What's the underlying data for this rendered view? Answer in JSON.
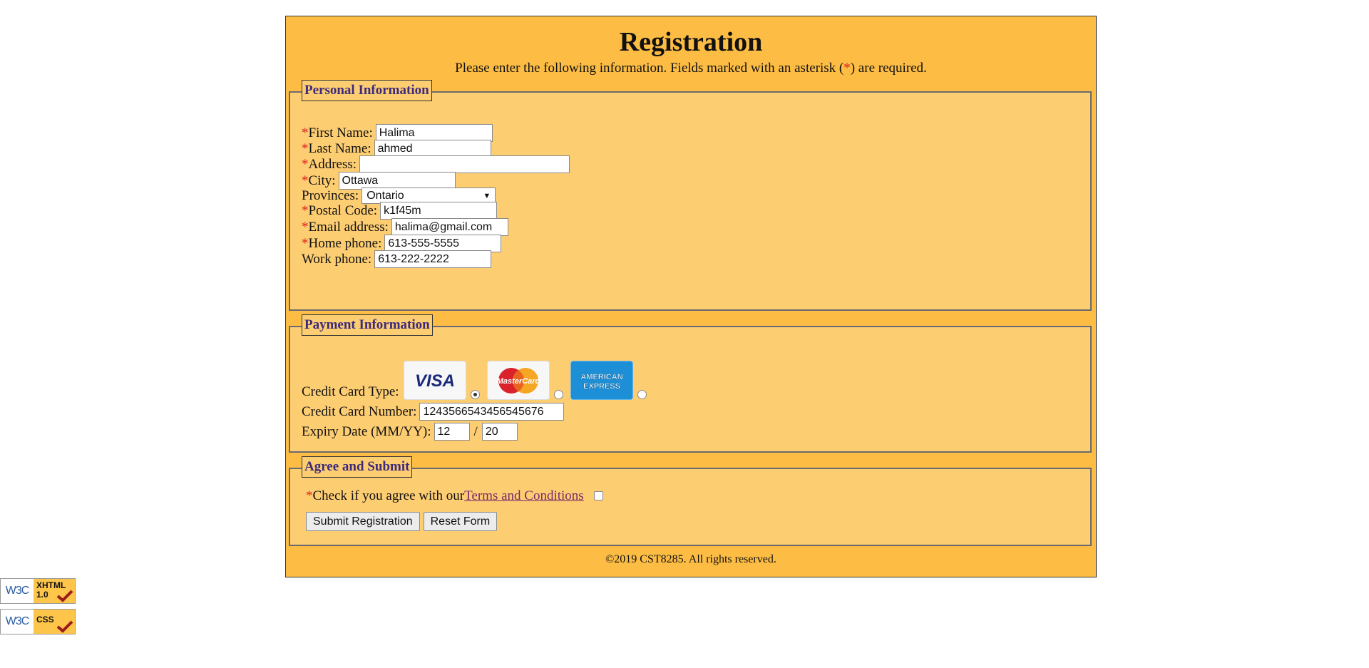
{
  "header": {
    "title": "Registration",
    "intro_before": "Please enter the following information. Fields marked with an asterisk (",
    "intro_asterisk": "*",
    "intro_after": ") are required."
  },
  "personal": {
    "legend": "Personal Information",
    "first_name": {
      "label": "First Name:",
      "value": "Halima"
    },
    "last_name": {
      "label": "Last Name:",
      "value": "ahmed"
    },
    "address": {
      "label": "Address:",
      "value": ""
    },
    "city": {
      "label": "City:",
      "value": "Ottawa"
    },
    "province": {
      "label": "Provinces:",
      "value": "Ontario"
    },
    "postal": {
      "label": "Postal Code:",
      "value": "k1f45m"
    },
    "email": {
      "label": "Email address:",
      "value": "halima@gmail.com"
    },
    "home_phone": {
      "label": "Home phone:",
      "value": "613-555-5555"
    },
    "work_phone": {
      "label": "Work phone:",
      "value": "613-222-2222"
    }
  },
  "payment": {
    "legend": "Payment Information",
    "card_type_label": "Credit Card Type:",
    "cards": [
      {
        "name": "VISA",
        "icon": "visa-card-icon",
        "selected": true
      },
      {
        "name": "MasterCard",
        "icon": "mastercard-card-icon",
        "selected": false
      },
      {
        "name": "AMERICAN EXPRESS",
        "icon": "amex-card-icon",
        "selected": false
      }
    ],
    "card_number": {
      "label": "Credit Card Number:",
      "value": "1243566543456545676"
    },
    "expiry": {
      "label": "Expiry Date (MM/YY):",
      "month": "12",
      "separator": "/",
      "year": "20"
    }
  },
  "agree": {
    "legend": "Agree and Submit",
    "asterisk": "*",
    "text": " Check if you agree with our",
    "link": " Terms and Conditions",
    "submit_label": "Submit Registration",
    "reset_label": "Reset Form"
  },
  "footer": {
    "text": "©2019 CST8285. All rights reserved."
  },
  "badges": {
    "xhtml": {
      "w3c": "W3C",
      "line1": "XHTML",
      "line2": "1.0"
    },
    "css": {
      "w3c": "W3C",
      "line1": "CSS"
    }
  },
  "colors": {
    "page_bg": "#fdbd44",
    "fieldset_bg": "#fdcd72",
    "required": "#e02020",
    "legend_text": "#3c2a7a",
    "link": "#7a2a6a"
  }
}
